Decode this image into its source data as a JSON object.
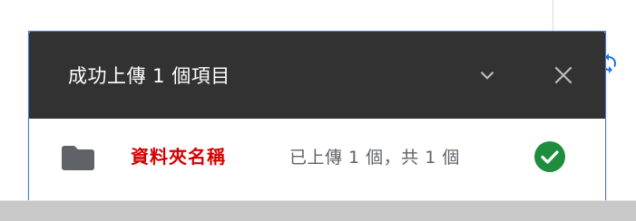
{
  "upload_panel": {
    "title": "成功上傳 1 個項目",
    "collapse_icon": "chevron-down-icon",
    "close_icon": "close-icon",
    "items": [
      {
        "icon": "folder-icon",
        "name": "資料夾名稱",
        "status": "已上傳 1 個，共 1 個",
        "status_icon": "check-circle-icon"
      }
    ]
  },
  "colors": {
    "header_bg": "#323232",
    "item_name": "#d50000",
    "success": "#1e8e3e",
    "accent": "#1a73e8"
  },
  "background": {
    "sync_icon": "sync-icon"
  }
}
